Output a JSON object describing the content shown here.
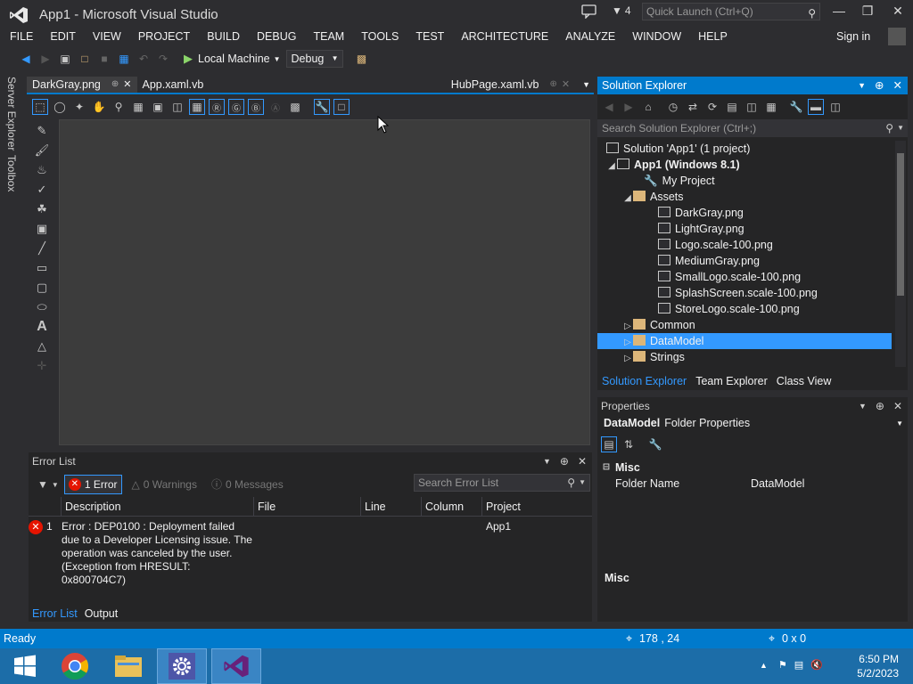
{
  "window": {
    "title": "App1 - Microsoft Visual Studio",
    "feedback_count": "4",
    "quick_launch_placeholder": "Quick Launch (Ctrl+Q)",
    "minimize": "—",
    "maximize": "❐",
    "close": "✕"
  },
  "menu": [
    "FILE",
    "EDIT",
    "VIEW",
    "PROJECT",
    "BUILD",
    "DEBUG",
    "TEAM",
    "TOOLS",
    "TEST",
    "ARCHITECTURE",
    "ANALYZE",
    "WINDOW",
    "HELP"
  ],
  "signin": "Sign in",
  "toolbar": {
    "run_label": "Local Machine",
    "config_value": "Debug"
  },
  "left_rail": [
    "Server Explorer",
    "Toolbox"
  ],
  "doc_tabs": {
    "active": "DarkGray.png",
    "second": "App.xaml.vb",
    "right": "HubPage.xaml.vb"
  },
  "error_list": {
    "title": "Error List",
    "errors_btn": "1 Error",
    "warnings_btn": "0 Warnings",
    "messages_btn": "0 Messages",
    "search_placeholder": "Search Error List",
    "columns": [
      "Description",
      "File",
      "Line",
      "Column",
      "Project"
    ],
    "row": {
      "index": "1",
      "description": "Error : DEP0100 : Deployment failed due to a Developer Licensing issue. The operation was canceled by the user. (Exception from HRESULT: 0x800704C7)",
      "project": "App1"
    },
    "tabs": [
      "Error List",
      "Output"
    ]
  },
  "solution_explorer": {
    "title": "Solution Explorer",
    "search_placeholder": "Search Solution Explorer (Ctrl+;)",
    "tree": [
      {
        "label": "Solution 'App1' (1 project)",
        "indent": 0,
        "icon": "solution"
      },
      {
        "label": "App1 (Windows 8.1)",
        "indent": 1,
        "icon": "vb-project",
        "bold": true,
        "expanded": true
      },
      {
        "label": "My Project",
        "indent": 2,
        "icon": "wrench"
      },
      {
        "label": "Assets",
        "indent": 2,
        "icon": "folder",
        "expanded": true
      },
      {
        "label": "DarkGray.png",
        "indent": 3,
        "icon": "image"
      },
      {
        "label": "LightGray.png",
        "indent": 3,
        "icon": "image"
      },
      {
        "label": "Logo.scale-100.png",
        "indent": 3,
        "icon": "image"
      },
      {
        "label": "MediumGray.png",
        "indent": 3,
        "icon": "image"
      },
      {
        "label": "SmallLogo.scale-100.png",
        "indent": 3,
        "icon": "image"
      },
      {
        "label": "SplashScreen.scale-100.png",
        "indent": 3,
        "icon": "image"
      },
      {
        "label": "StoreLogo.scale-100.png",
        "indent": 3,
        "icon": "image"
      },
      {
        "label": "Common",
        "indent": 2,
        "icon": "folder",
        "collapsed": true
      },
      {
        "label": "DataModel",
        "indent": 2,
        "icon": "folder",
        "collapsed": true,
        "selected": true
      },
      {
        "label": "Strings",
        "indent": 2,
        "icon": "folder",
        "collapsed": true
      }
    ],
    "tabs": [
      "Solution Explorer",
      "Team Explorer",
      "Class View"
    ]
  },
  "properties": {
    "title": "Properties",
    "object_name": "DataModel",
    "object_type": "Folder Properties",
    "category": "Misc",
    "rows": [
      {
        "name": "Folder Name",
        "value": "DataModel"
      }
    ],
    "description_title": "Misc"
  },
  "status": {
    "text": "Ready",
    "position": "178 , 24",
    "size": "0 x 0"
  },
  "taskbar": {
    "time": "6:50 PM",
    "date": "5/2/2023"
  },
  "colors": {
    "accent": "#007acc",
    "selection": "#3399ff",
    "error": "#e51400",
    "run": "#8bd56a"
  }
}
